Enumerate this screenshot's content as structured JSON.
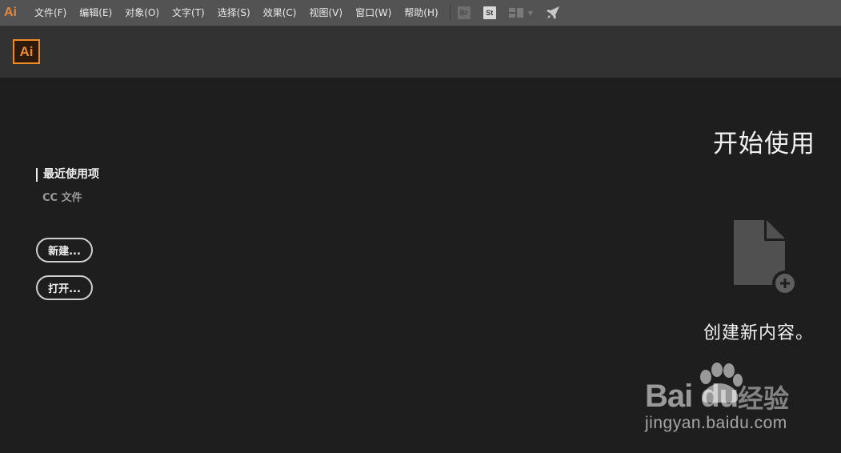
{
  "app": {
    "logo_small": "Ai",
    "logo": "Ai"
  },
  "menu": [
    {
      "id": "file",
      "label": "文件(F)"
    },
    {
      "id": "edit",
      "label": "编辑(E)"
    },
    {
      "id": "object",
      "label": "对象(O)"
    },
    {
      "id": "type",
      "label": "文字(T)"
    },
    {
      "id": "select",
      "label": "选择(S)"
    },
    {
      "id": "effect",
      "label": "效果(C)"
    },
    {
      "id": "view",
      "label": "视图(V)"
    },
    {
      "id": "window",
      "label": "窗口(W)"
    },
    {
      "id": "help",
      "label": "帮助(H)"
    }
  ],
  "toolbar": {
    "bridge": "Br",
    "stock": "St"
  },
  "icons": [
    "bridge-icon",
    "stock-icon",
    "workspace-icon",
    "chevron-down-icon",
    "rocket-icon",
    "new-document-icon",
    "plus-icon",
    "baidu-paw-icon"
  ],
  "nav": {
    "recent": "最近使用项",
    "cc_files": "CC 文件"
  },
  "buttons": {
    "new": "新建...",
    "open": "打开..."
  },
  "start": {
    "title": "开始使用",
    "create": "创建新内容。"
  },
  "watermark": {
    "brand": "Bai du",
    "jingyan": "经验",
    "url": "jingyan.baidu.com"
  },
  "colors": {
    "accent": "#f08a24",
    "menubar": "#535353",
    "header": "#323232",
    "background": "#1e1e1e"
  }
}
